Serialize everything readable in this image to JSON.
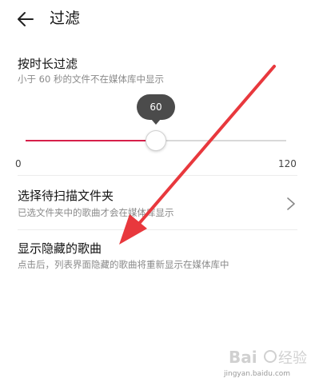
{
  "header": {
    "title": "过滤",
    "back_icon": "arrow-left-icon"
  },
  "duration_filter": {
    "title": "按时长过滤",
    "subtitle": "小于 60 秒的文件不在媒体库中显示",
    "slider": {
      "value": 60,
      "min": 0,
      "max": 120,
      "value_label": "60",
      "min_label": "0",
      "max_label": "120"
    }
  },
  "scan_folders": {
    "title": "选择待扫描文件夹",
    "subtitle": "已选文件夹中的歌曲才会在媒体库显示",
    "chevron_icon": "chevron-right-icon"
  },
  "hidden_songs": {
    "title": "显示隐藏的歌曲",
    "subtitle": "点击后，列表界面隐藏的歌曲将重新显示在媒体库中"
  },
  "watermark": {
    "text": "jingyan.baidu.com"
  },
  "colors": {
    "accent": "#d6204a",
    "arrow": "#e8383d",
    "tooltip": "#4b4b4b"
  }
}
